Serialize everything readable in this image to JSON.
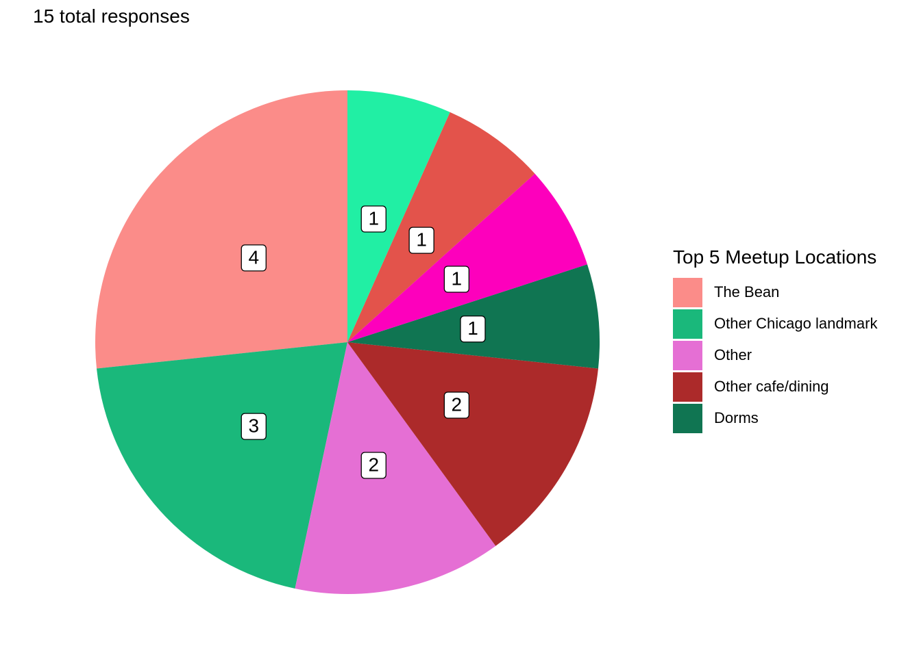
{
  "subtitle": "15 total responses",
  "chart_data": {
    "type": "pie",
    "legend_title": "Top 5 Meetup Locations",
    "legend_position": "right",
    "total": 15,
    "slices": [
      {
        "label": "The Bean",
        "value": 4,
        "color": "#FB8C89"
      },
      {
        "label": "Other Chicago landmark",
        "value": 3,
        "color": "#1AB87B"
      },
      {
        "label": "Other",
        "value": 2,
        "color": "#E56FD4"
      },
      {
        "label": "Other cafe/dining",
        "value": 2,
        "color": "#AC2A2A"
      },
      {
        "label": "Dorms",
        "value": 1,
        "color": "#107552"
      },
      {
        "label": "",
        "value": 1,
        "color": "#FD00BC"
      },
      {
        "label": "",
        "value": 1,
        "color": "#E3534B"
      },
      {
        "label": "",
        "value": 1,
        "color": "#21EFA4"
      }
    ],
    "legend": [
      {
        "label": "The Bean",
        "color": "#FB8C89"
      },
      {
        "label": "Other Chicago landmark",
        "color": "#1AB87B"
      },
      {
        "label": "Other",
        "color": "#E56FD4"
      },
      {
        "label": "Other cafe/dining",
        "color": "#AC2A2A"
      },
      {
        "label": "Dorms",
        "color": "#107552"
      }
    ]
  }
}
